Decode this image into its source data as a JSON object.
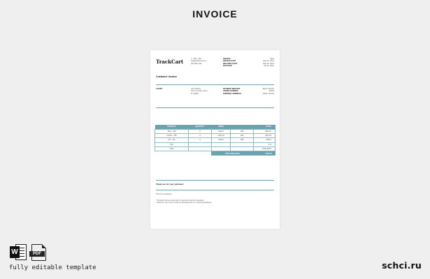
{
  "header": {
    "title": "INVOICE"
  },
  "invoice": {
    "brand": "TrackCart",
    "contact_lines": [
      "1 - 555 - 000",
      "info@trackcart.com",
      "222 000 1111"
    ],
    "meta_labels": [
      "INVOICE",
      "INVOICE DATE",
      "DELIVERY DATE",
      "DUE DATE"
    ],
    "meta_values": [
      "0001",
      "May 22, 2021",
      "May 26, 2021",
      "Jun 22, 2021"
    ],
    "document_title": "Customer Invoice",
    "client_label": "CLIENT",
    "client_lines": [
      "John Wilson",
      "200 Innovation Drive",
      "FL 33020"
    ],
    "shipping_labels": [
      "PAYMENT METHOD",
      "ORDER NUMBER",
      "SHIPPING ADDRESS"
    ],
    "shipping_values": [
      "Bank Transfer",
      "00004",
      "33020, Florida"
    ],
    "table": {
      "headers": [
        "PRODUCT",
        "QUANTITY",
        "PRICE",
        "",
        "TOTAL"
      ],
      "rows": [
        [
          "SKU - 243",
          "2",
          "USD 6",
          "48h",
          "USD 12"
        ],
        [
          "GOLD - 785",
          "3",
          "USD 10",
          "48h",
          "USD 30"
        ],
        [
          "KIT - 111",
          "4",
          "USD 1",
          "48h",
          "USD 4"
        ],
        [
          "TAX",
          "",
          "",
          "",
          "4 %"
        ],
        [
          "Total",
          "",
          "",
          "",
          "USD 48.16"
        ]
      ],
      "grand_total_label": "USD TOTAL DUE",
      "grand_total_value": "USD 48"
    },
    "thanks": "Thank you for your purchase!",
    "terms_title": "Terms & Conditions",
    "terms_lines": [
      "* Products that are returned by customers will be inspected.",
      "* Refunds may not be made on damaged items or opened packaging."
    ]
  },
  "footer": {
    "word_icon_letter": "W",
    "pdf_icon_label": "PDF",
    "caption": "fully editable template",
    "site": "schci.ru"
  },
  "colors": {
    "accent": "#6aa3b0",
    "background": "#efefef"
  }
}
